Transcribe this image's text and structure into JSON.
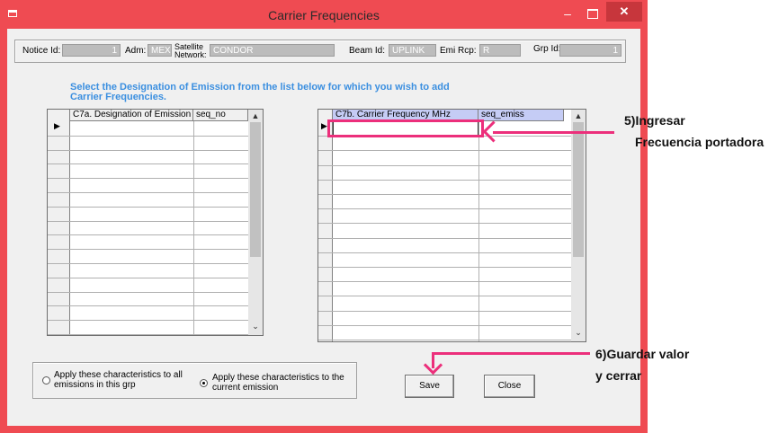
{
  "window": {
    "title": "Carrier Frequencies",
    "minimize": "–",
    "close": "✕",
    "frame_color": "#ef4b52"
  },
  "header": {
    "notice_id_label": "Notice Id:",
    "notice_id_value": "1",
    "adm_label": "Adm:",
    "adm_value": "MEX",
    "satellite_label_1": "Satellite",
    "satellite_label_2": "Network:",
    "satellite_value": "CONDOR",
    "beam_label": "Beam Id:",
    "beam_value": "UPLINK",
    "emi_label": "Emi Rcp:",
    "emi_value": "R",
    "grp_label": "Grp Id:",
    "grp_value": "1"
  },
  "instruction": {
    "line1": "Select the Designation of Emission from the list below for which you wish to add",
    "line2": "Carrier Frequencies.",
    "color": "#3b8fe0"
  },
  "left_grid": {
    "columns": [
      "C7a. Designation of Emission",
      "seq_no"
    ],
    "row_marker": "▶"
  },
  "right_grid": {
    "columns": [
      "C7b.  Carrier Frequency MHz",
      "seq_emiss"
    ],
    "row_marker": "▶"
  },
  "scroll": {
    "up": "▲",
    "down": "⌄"
  },
  "options": {
    "all_line1": "Apply these characteristics to all",
    "all_line2": "emissions in this grp",
    "current_line1": "Apply these characteristics to the",
    "current_line2": "current emission",
    "selected": "current"
  },
  "buttons": {
    "save": "Save",
    "close": "Close"
  },
  "annotations": {
    "step5_line1": "5)Ingresar",
    "step5_line2": "Frecuencia portadora",
    "step6_line1": "6)Guardar valor",
    "step6_line2": "y cerrar",
    "color": "#ec2f7b"
  }
}
